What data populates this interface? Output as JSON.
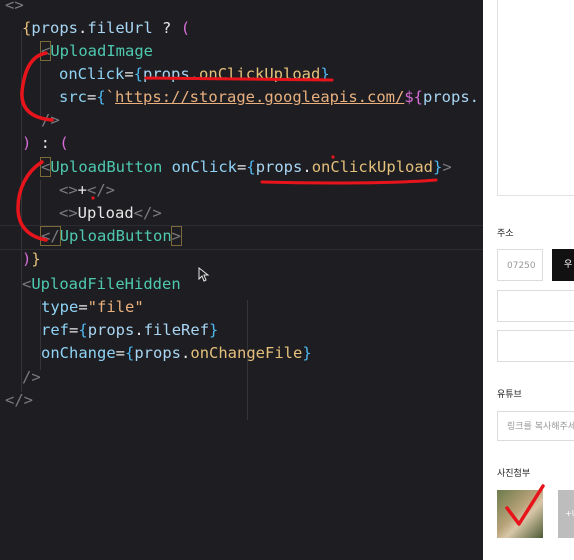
{
  "editor": {
    "lines": [
      {
        "id": "l0",
        "tokens": [
          {
            "c": "tg",
            "t": "<>"
          }
        ]
      },
      {
        "id": "l1",
        "tokens": [
          {
            "c": "br",
            "t": "{"
          },
          {
            "c": "prp",
            "t": "props"
          },
          {
            "c": "txt",
            "t": "."
          },
          {
            "c": "prp",
            "t": "fileUrl"
          },
          {
            "c": "txt",
            "t": " ? "
          },
          {
            "c": "br2",
            "t": "("
          }
        ]
      },
      {
        "id": "l2",
        "tokens": [
          {
            "c": "tg",
            "t": "<"
          },
          {
            "c": "cmp",
            "t": "UploadImage"
          }
        ]
      },
      {
        "id": "l3",
        "tokens": [
          {
            "c": "att",
            "t": "onClick"
          },
          {
            "c": "txt",
            "t": "="
          },
          {
            "c": "br3",
            "t": "{"
          },
          {
            "c": "prp",
            "t": "props"
          },
          {
            "c": "txt",
            "t": "."
          },
          {
            "c": "tmpl",
            "t": "onClickUpload"
          },
          {
            "c": "br3",
            "t": "}"
          }
        ]
      },
      {
        "id": "l4",
        "tokens": [
          {
            "c": "att",
            "t": "src"
          },
          {
            "c": "txt",
            "t": "="
          },
          {
            "c": "br3",
            "t": "{"
          },
          {
            "c": "str",
            "t": "`"
          },
          {
            "c": "url",
            "t": "https://storage.googleapis.com/"
          },
          {
            "c": "br2",
            "t": "${"
          },
          {
            "c": "prp",
            "t": "props."
          }
        ]
      },
      {
        "id": "l5",
        "tokens": [
          {
            "c": "tg",
            "t": "/>"
          }
        ]
      },
      {
        "id": "l6",
        "tokens": [
          {
            "c": "br2",
            "t": ")"
          },
          {
            "c": "txt",
            "t": " : "
          },
          {
            "c": "br2",
            "t": "("
          }
        ]
      },
      {
        "id": "l7",
        "tokens": [
          {
            "c": "tg",
            "t": "<"
          },
          {
            "c": "cmp",
            "t": "UploadButton"
          },
          {
            "c": "txt",
            "t": " "
          },
          {
            "c": "att",
            "t": "onClick"
          },
          {
            "c": "txt",
            "t": "="
          },
          {
            "c": "br3",
            "t": "{"
          },
          {
            "c": "prp",
            "t": "props"
          },
          {
            "c": "txt",
            "t": "."
          },
          {
            "c": "tmpl",
            "t": "onClickUpload"
          },
          {
            "c": "br3",
            "t": "}"
          },
          {
            "c": "tg",
            "t": ">"
          }
        ]
      },
      {
        "id": "l8",
        "tokens": [
          {
            "c": "tg",
            "t": "<>"
          },
          {
            "c": "txt",
            "t": "+"
          },
          {
            "c": "tg",
            "t": "</>"
          }
        ]
      },
      {
        "id": "l9",
        "tokens": [
          {
            "c": "tg",
            "t": "<>"
          },
          {
            "c": "txt",
            "t": "Upload"
          },
          {
            "c": "tg",
            "t": "</>"
          }
        ]
      },
      {
        "id": "l10",
        "tokens": [
          {
            "c": "tg",
            "t": "</"
          },
          {
            "c": "cmp",
            "t": "UploadButton"
          },
          {
            "c": "tg",
            "t": ">"
          }
        ]
      },
      {
        "id": "l11",
        "tokens": [
          {
            "c": "br2",
            "t": ")"
          },
          {
            "c": "br",
            "t": "}"
          }
        ]
      },
      {
        "id": "l12",
        "tokens": [
          {
            "c": "tg",
            "t": "<"
          },
          {
            "c": "cmp",
            "t": "UploadFileHidden"
          }
        ]
      },
      {
        "id": "l13",
        "tokens": [
          {
            "c": "att",
            "t": "type"
          },
          {
            "c": "txt",
            "t": "="
          },
          {
            "c": "str",
            "t": "\"file\""
          }
        ]
      },
      {
        "id": "l14",
        "tokens": [
          {
            "c": "att",
            "t": "ref"
          },
          {
            "c": "txt",
            "t": "="
          },
          {
            "c": "br3",
            "t": "{"
          },
          {
            "c": "prp",
            "t": "props"
          },
          {
            "c": "txt",
            "t": "."
          },
          {
            "c": "prp",
            "t": "fileRef"
          },
          {
            "c": "br3",
            "t": "}"
          }
        ]
      },
      {
        "id": "l15",
        "tokens": [
          {
            "c": "att",
            "t": "onChange"
          },
          {
            "c": "txt",
            "t": "="
          },
          {
            "c": "br3",
            "t": "{"
          },
          {
            "c": "prp",
            "t": "props"
          },
          {
            "c": "txt",
            "t": "."
          },
          {
            "c": "tmpl",
            "t": "onChangeFile"
          },
          {
            "c": "br3",
            "t": "}"
          }
        ]
      },
      {
        "id": "l16",
        "tokens": [
          {
            "c": "tg",
            "t": "/>"
          }
        ]
      },
      {
        "id": "l17",
        "tokens": [
          {
            "c": "tg",
            "t": "</>"
          }
        ]
      }
    ]
  },
  "panel": {
    "address_label": "주소",
    "zipcode_value": "07250",
    "search_button_label": "우",
    "youtube_label": "유튜브",
    "youtube_placeholder": "링크를 복사해주세요",
    "photo_label": "사진첨부",
    "add_photo_label": "+U"
  },
  "colors": {
    "editor_bg": "#1e1e22",
    "component": "#4ec9b0",
    "annotation_red": "#e8141c"
  }
}
